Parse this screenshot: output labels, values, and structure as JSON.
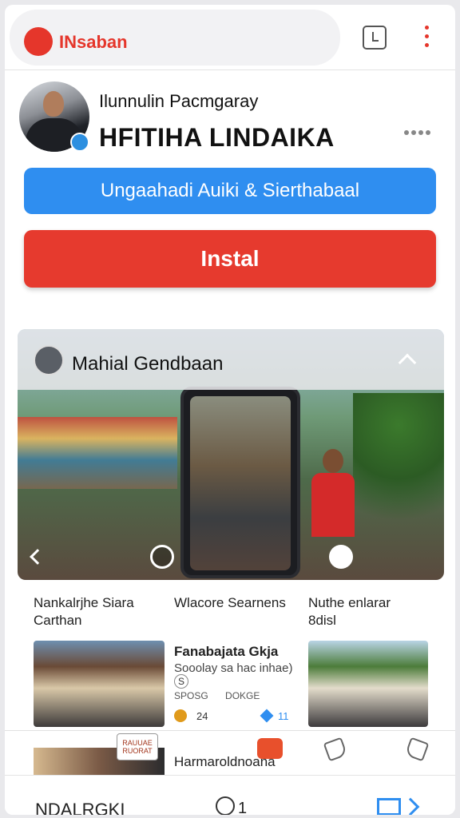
{
  "app": {
    "name": "INsaban"
  },
  "profile": {
    "subtitle": "Ilunnulin Pacmgaray",
    "name": "HFITIHA LINDAIKA"
  },
  "buttons": {
    "primary_label": "Ungaahadi Auiki & Sierthabaal",
    "install_label": "Instal"
  },
  "card": {
    "title": "Mahial Gendbaan"
  },
  "captions": [
    {
      "line1": "Nankalrjhe Siara",
      "line2": "Carthan"
    },
    {
      "line1": "Wlacore Searnens",
      "line2": ""
    },
    {
      "line1": "Nuthe enlarar",
      "line2": "8disl"
    }
  ],
  "post": {
    "title": "Fanabajata Gkja",
    "meta": "Sooolay sa hac inhae)",
    "tag": "S",
    "stats": [
      "SPOSG",
      "DOKGE"
    ],
    "like_count": "24",
    "reply_count": "11"
  },
  "row3": {
    "chip_label": "RAUUAE RUORAT",
    "title": "Harmaroldnoana"
  },
  "bottombar": {
    "label": "NDALRGKI",
    "count": "1"
  },
  "colors": {
    "brand": "#e5362b",
    "accent": "#2f8ef0",
    "install": "#e63a2e"
  },
  "icons": [
    "brand-logo",
    "bookmark-icon",
    "more-vert-icon",
    "verified-badge-icon",
    "more-horiz-icon",
    "collapse-chevron-icon",
    "back-icon",
    "record-icon",
    "play-icon",
    "sun-icon",
    "heart-icon",
    "gift-icon",
    "thumb-down-icon",
    "thumb-up-icon",
    "circle-icon",
    "forward-icon"
  ]
}
